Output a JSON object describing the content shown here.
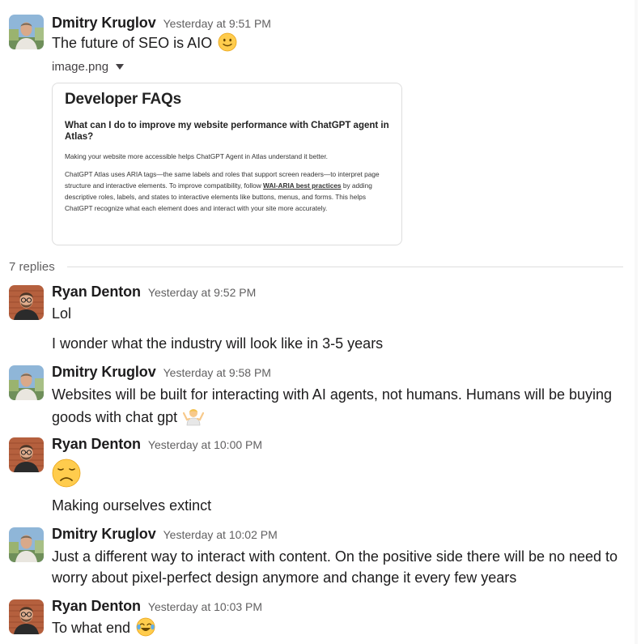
{
  "thread": {
    "parent": {
      "author": "Dmitry Kruglov",
      "timestamp": "Yesterday at 9:51 PM",
      "text": "The future of SEO is AIO",
      "emoji": "slightly-smiling-face",
      "attachment": {
        "filename": "image.png",
        "preview": {
          "title": "Developer FAQs",
          "question": "What can I do to improve my website performance with ChatGPT agent in Atlas?",
          "para1": "Making your website more accessible helps ChatGPT Agent in Atlas understand it better.",
          "para2_pre": "ChatGPT Atlas uses ARIA tags—the same labels and roles that support screen readers—to interpret page structure and interactive elements. To improve compatibility, follow ",
          "para2_link": "WAI-ARIA best practices",
          "para2_post": " by adding descriptive roles, labels, and states to interactive elements like buttons, menus, and forms. This helps ChatGPT recognize what each element does and interact with your site more accurately."
        }
      }
    },
    "replies_label": "7 replies",
    "messages": [
      {
        "author": "Ryan Denton",
        "timestamp": "Yesterday at 9:52 PM",
        "lines": [
          "Lol",
          "I wonder what the industry will look like in 3-5 years"
        ]
      },
      {
        "author": "Dmitry Kruglov",
        "timestamp": "Yesterday at 9:58 PM",
        "lines": [
          "Websites will be built for interacting with AI agents, not humans. Humans will be buying",
          "goods with chat gpt"
        ],
        "emoji": "person-shrugging"
      },
      {
        "author": "Ryan Denton",
        "timestamp": "Yesterday at 10:00 PM",
        "emoji": "disappointed-face",
        "lines": [
          "Making ourselves extinct"
        ]
      },
      {
        "author": "Dmitry Kruglov",
        "timestamp": "Yesterday at 10:02 PM",
        "lines": [
          "Just a different way to interact with content. On the positive side there will be no need to",
          "worry about pixel-perfect design anymore and change it  every few years"
        ]
      },
      {
        "author": "Ryan Denton",
        "timestamp": "Yesterday at 10:03 PM",
        "lines": [
          "To what end"
        ],
        "emoji": "face-with-tears-of-joy"
      }
    ]
  }
}
